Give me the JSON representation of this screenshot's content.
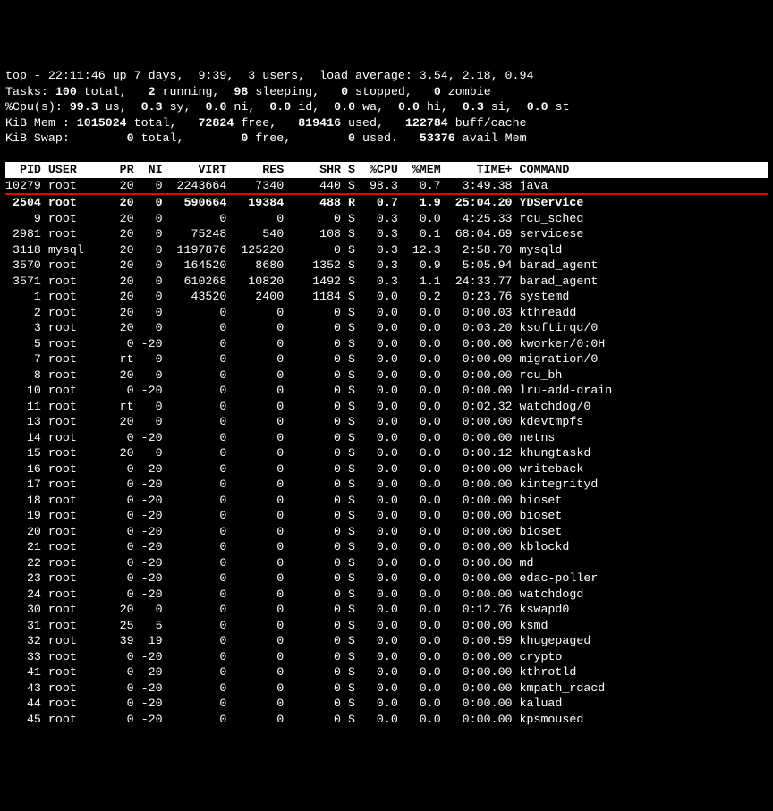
{
  "summary": {
    "line1": "top - 22:11:46 up 7 days,  9:39,  3 users,  load average: 3.54, 2.18, 0.94",
    "line2": {
      "pre": "Tasks: ",
      "total": "100",
      "mid1": " total,   ",
      "run": "2",
      "mid2": " running,  ",
      "sleep": "98",
      "mid3": " sleeping,   ",
      "stop": "0",
      "mid4": " stopped,   ",
      "zomb": "0",
      "mid5": " zombie"
    },
    "line3": {
      "pre": "%Cpu(s): ",
      "us": "99.3",
      "m1": " us,  ",
      "sy": "0.3",
      "m2": " sy,  ",
      "ni": "0.0",
      "m3": " ni,  ",
      "id": "0.0",
      "m4": " id,  ",
      "wa": "0.0",
      "m5": " wa,  ",
      "hi": "0.0",
      "m6": " hi,  ",
      "si": "0.3",
      "m7": " si,  ",
      "st": "0.0",
      "m8": " st"
    },
    "line4": {
      "pre": "KiB Mem : ",
      "total": "1015024",
      "m1": " total,   ",
      "free": "72824",
      "m2": " free,   ",
      "used": "819416",
      "m3": " used,   ",
      "buff": "122784",
      "m4": " buff/cache"
    },
    "line5": {
      "pre": "KiB Swap:        ",
      "total": "0",
      "m1": " total,        ",
      "free": "0",
      "m2": " free,        ",
      "used": "0",
      "m3": " used.   ",
      "avail": "53376",
      "m4": " avail Mem"
    }
  },
  "columns": [
    "PID",
    "USER",
    "PR",
    "NI",
    "VIRT",
    "RES",
    "SHR",
    "S",
    "%CPU",
    "%MEM",
    "TIME+",
    "COMMAND"
  ],
  "procs": [
    {
      "pid": "10279",
      "user": "root",
      "pr": "20",
      "ni": "0",
      "virt": "2243664",
      "res": "7340",
      "shr": "440",
      "s": "S",
      "cpu": "98.3",
      "mem": "0.7",
      "time": "3:49.38",
      "cmd": "java",
      "hl": false,
      "redafter": true
    },
    {
      "pid": "2504",
      "user": "root",
      "pr": "20",
      "ni": "0",
      "virt": "590664",
      "res": "19384",
      "shr": "488",
      "s": "R",
      "cpu": "0.7",
      "mem": "1.9",
      "time": "25:04.20",
      "cmd": "YDService",
      "hl": true
    },
    {
      "pid": "9",
      "user": "root",
      "pr": "20",
      "ni": "0",
      "virt": "0",
      "res": "0",
      "shr": "0",
      "s": "S",
      "cpu": "0.3",
      "mem": "0.0",
      "time": "4:25.33",
      "cmd": "rcu_sched"
    },
    {
      "pid": "2981",
      "user": "root",
      "pr": "20",
      "ni": "0",
      "virt": "75248",
      "res": "540",
      "shr": "108",
      "s": "S",
      "cpu": "0.3",
      "mem": "0.1",
      "time": "68:04.69",
      "cmd": "servicese"
    },
    {
      "pid": "3118",
      "user": "mysql",
      "pr": "20",
      "ni": "0",
      "virt": "1197876",
      "res": "125220",
      "shr": "0",
      "s": "S",
      "cpu": "0.3",
      "mem": "12.3",
      "time": "2:58.70",
      "cmd": "mysqld"
    },
    {
      "pid": "3570",
      "user": "root",
      "pr": "20",
      "ni": "0",
      "virt": "164520",
      "res": "8680",
      "shr": "1352",
      "s": "S",
      "cpu": "0.3",
      "mem": "0.9",
      "time": "5:05.94",
      "cmd": "barad_agent"
    },
    {
      "pid": "3571",
      "user": "root",
      "pr": "20",
      "ni": "0",
      "virt": "610268",
      "res": "10820",
      "shr": "1492",
      "s": "S",
      "cpu": "0.3",
      "mem": "1.1",
      "time": "24:33.77",
      "cmd": "barad_agent"
    },
    {
      "pid": "1",
      "user": "root",
      "pr": "20",
      "ni": "0",
      "virt": "43520",
      "res": "2400",
      "shr": "1184",
      "s": "S",
      "cpu": "0.0",
      "mem": "0.2",
      "time": "0:23.76",
      "cmd": "systemd"
    },
    {
      "pid": "2",
      "user": "root",
      "pr": "20",
      "ni": "0",
      "virt": "0",
      "res": "0",
      "shr": "0",
      "s": "S",
      "cpu": "0.0",
      "mem": "0.0",
      "time": "0:00.03",
      "cmd": "kthreadd"
    },
    {
      "pid": "3",
      "user": "root",
      "pr": "20",
      "ni": "0",
      "virt": "0",
      "res": "0",
      "shr": "0",
      "s": "S",
      "cpu": "0.0",
      "mem": "0.0",
      "time": "0:03.20",
      "cmd": "ksoftirqd/0"
    },
    {
      "pid": "5",
      "user": "root",
      "pr": "0",
      "ni": "-20",
      "virt": "0",
      "res": "0",
      "shr": "0",
      "s": "S",
      "cpu": "0.0",
      "mem": "0.0",
      "time": "0:00.00",
      "cmd": "kworker/0:0H"
    },
    {
      "pid": "7",
      "user": "root",
      "pr": "rt",
      "ni": "0",
      "virt": "0",
      "res": "0",
      "shr": "0",
      "s": "S",
      "cpu": "0.0",
      "mem": "0.0",
      "time": "0:00.00",
      "cmd": "migration/0"
    },
    {
      "pid": "8",
      "user": "root",
      "pr": "20",
      "ni": "0",
      "virt": "0",
      "res": "0",
      "shr": "0",
      "s": "S",
      "cpu": "0.0",
      "mem": "0.0",
      "time": "0:00.00",
      "cmd": "rcu_bh"
    },
    {
      "pid": "10",
      "user": "root",
      "pr": "0",
      "ni": "-20",
      "virt": "0",
      "res": "0",
      "shr": "0",
      "s": "S",
      "cpu": "0.0",
      "mem": "0.0",
      "time": "0:00.00",
      "cmd": "lru-add-drain"
    },
    {
      "pid": "11",
      "user": "root",
      "pr": "rt",
      "ni": "0",
      "virt": "0",
      "res": "0",
      "shr": "0",
      "s": "S",
      "cpu": "0.0",
      "mem": "0.0",
      "time": "0:02.32",
      "cmd": "watchdog/0"
    },
    {
      "pid": "13",
      "user": "root",
      "pr": "20",
      "ni": "0",
      "virt": "0",
      "res": "0",
      "shr": "0",
      "s": "S",
      "cpu": "0.0",
      "mem": "0.0",
      "time": "0:00.00",
      "cmd": "kdevtmpfs"
    },
    {
      "pid": "14",
      "user": "root",
      "pr": "0",
      "ni": "-20",
      "virt": "0",
      "res": "0",
      "shr": "0",
      "s": "S",
      "cpu": "0.0",
      "mem": "0.0",
      "time": "0:00.00",
      "cmd": "netns"
    },
    {
      "pid": "15",
      "user": "root",
      "pr": "20",
      "ni": "0",
      "virt": "0",
      "res": "0",
      "shr": "0",
      "s": "S",
      "cpu": "0.0",
      "mem": "0.0",
      "time": "0:00.12",
      "cmd": "khungtaskd"
    },
    {
      "pid": "16",
      "user": "root",
      "pr": "0",
      "ni": "-20",
      "virt": "0",
      "res": "0",
      "shr": "0",
      "s": "S",
      "cpu": "0.0",
      "mem": "0.0",
      "time": "0:00.00",
      "cmd": "writeback"
    },
    {
      "pid": "17",
      "user": "root",
      "pr": "0",
      "ni": "-20",
      "virt": "0",
      "res": "0",
      "shr": "0",
      "s": "S",
      "cpu": "0.0",
      "mem": "0.0",
      "time": "0:00.00",
      "cmd": "kintegrityd"
    },
    {
      "pid": "18",
      "user": "root",
      "pr": "0",
      "ni": "-20",
      "virt": "0",
      "res": "0",
      "shr": "0",
      "s": "S",
      "cpu": "0.0",
      "mem": "0.0",
      "time": "0:00.00",
      "cmd": "bioset"
    },
    {
      "pid": "19",
      "user": "root",
      "pr": "0",
      "ni": "-20",
      "virt": "0",
      "res": "0",
      "shr": "0",
      "s": "S",
      "cpu": "0.0",
      "mem": "0.0",
      "time": "0:00.00",
      "cmd": "bioset"
    },
    {
      "pid": "20",
      "user": "root",
      "pr": "0",
      "ni": "-20",
      "virt": "0",
      "res": "0",
      "shr": "0",
      "s": "S",
      "cpu": "0.0",
      "mem": "0.0",
      "time": "0:00.00",
      "cmd": "bioset"
    },
    {
      "pid": "21",
      "user": "root",
      "pr": "0",
      "ni": "-20",
      "virt": "0",
      "res": "0",
      "shr": "0",
      "s": "S",
      "cpu": "0.0",
      "mem": "0.0",
      "time": "0:00.00",
      "cmd": "kblockd"
    },
    {
      "pid": "22",
      "user": "root",
      "pr": "0",
      "ni": "-20",
      "virt": "0",
      "res": "0",
      "shr": "0",
      "s": "S",
      "cpu": "0.0",
      "mem": "0.0",
      "time": "0:00.00",
      "cmd": "md"
    },
    {
      "pid": "23",
      "user": "root",
      "pr": "0",
      "ni": "-20",
      "virt": "0",
      "res": "0",
      "shr": "0",
      "s": "S",
      "cpu": "0.0",
      "mem": "0.0",
      "time": "0:00.00",
      "cmd": "edac-poller"
    },
    {
      "pid": "24",
      "user": "root",
      "pr": "0",
      "ni": "-20",
      "virt": "0",
      "res": "0",
      "shr": "0",
      "s": "S",
      "cpu": "0.0",
      "mem": "0.0",
      "time": "0:00.00",
      "cmd": "watchdogd"
    },
    {
      "pid": "30",
      "user": "root",
      "pr": "20",
      "ni": "0",
      "virt": "0",
      "res": "0",
      "shr": "0",
      "s": "S",
      "cpu": "0.0",
      "mem": "0.0",
      "time": "0:12.76",
      "cmd": "kswapd0"
    },
    {
      "pid": "31",
      "user": "root",
      "pr": "25",
      "ni": "5",
      "virt": "0",
      "res": "0",
      "shr": "0",
      "s": "S",
      "cpu": "0.0",
      "mem": "0.0",
      "time": "0:00.00",
      "cmd": "ksmd"
    },
    {
      "pid": "32",
      "user": "root",
      "pr": "39",
      "ni": "19",
      "virt": "0",
      "res": "0",
      "shr": "0",
      "s": "S",
      "cpu": "0.0",
      "mem": "0.0",
      "time": "0:00.59",
      "cmd": "khugepaged"
    },
    {
      "pid": "33",
      "user": "root",
      "pr": "0",
      "ni": "-20",
      "virt": "0",
      "res": "0",
      "shr": "0",
      "s": "S",
      "cpu": "0.0",
      "mem": "0.0",
      "time": "0:00.00",
      "cmd": "crypto"
    },
    {
      "pid": "41",
      "user": "root",
      "pr": "0",
      "ni": "-20",
      "virt": "0",
      "res": "0",
      "shr": "0",
      "s": "S",
      "cpu": "0.0",
      "mem": "0.0",
      "time": "0:00.00",
      "cmd": "kthrotld"
    },
    {
      "pid": "43",
      "user": "root",
      "pr": "0",
      "ni": "-20",
      "virt": "0",
      "res": "0",
      "shr": "0",
      "s": "S",
      "cpu": "0.0",
      "mem": "0.0",
      "time": "0:00.00",
      "cmd": "kmpath_rdacd"
    },
    {
      "pid": "44",
      "user": "root",
      "pr": "0",
      "ni": "-20",
      "virt": "0",
      "res": "0",
      "shr": "0",
      "s": "S",
      "cpu": "0.0",
      "mem": "0.0",
      "time": "0:00.00",
      "cmd": "kaluad"
    },
    {
      "pid": "45",
      "user": "root",
      "pr": "0",
      "ni": "-20",
      "virt": "0",
      "res": "0",
      "shr": "0",
      "s": "S",
      "cpu": "0.0",
      "mem": "0.0",
      "time": "0:00.00",
      "cmd": "kpsmoused"
    }
  ]
}
